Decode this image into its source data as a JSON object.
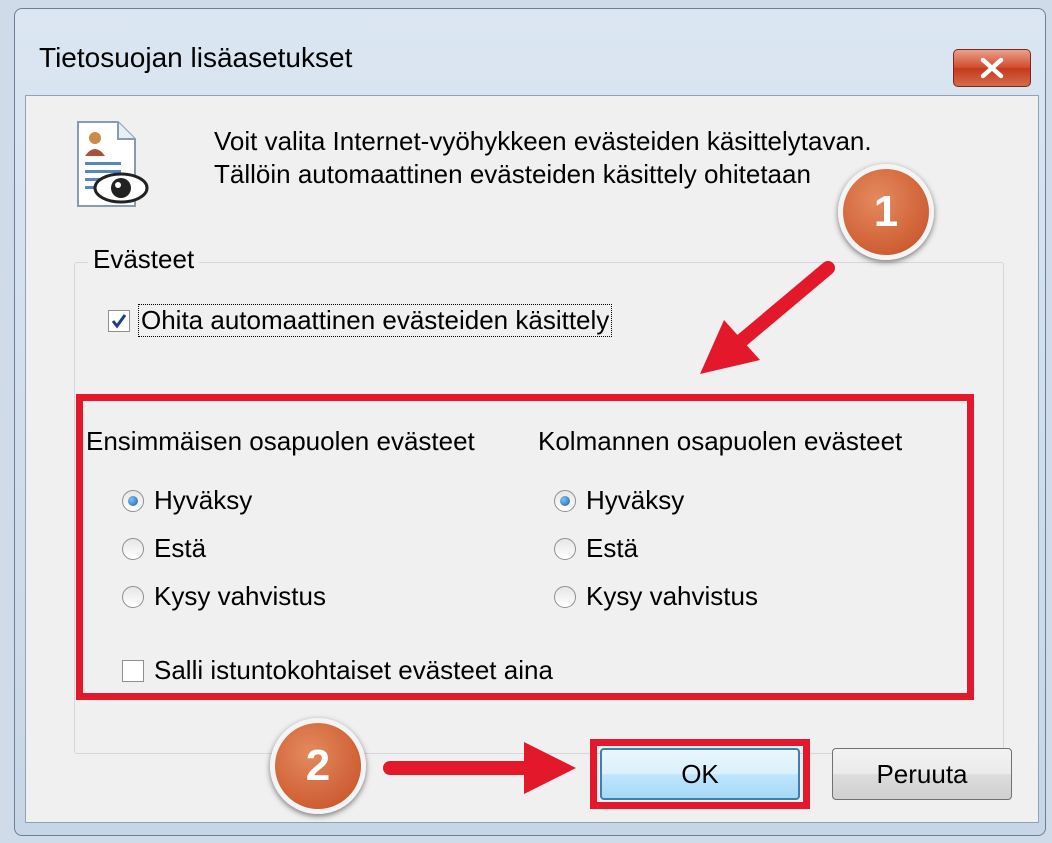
{
  "window": {
    "title": "Tietosuojan lisäasetukset",
    "close_icon": "close-x-icon"
  },
  "info": {
    "icon": "privacy-document-eye-icon",
    "line1": "Voit valita Internet-vyöhykkeen evästeiden käsittelytavan.",
    "line2": "Tällöin automaattinen evästeiden käsittely ohitetaan"
  },
  "cookies_group": {
    "label": "Evästeet",
    "override_label": "Ohita automaattinen evästeiden käsittely",
    "override_checked": true,
    "first_party": {
      "header": "Ensimmäisen osapuolen evästeet",
      "options": [
        "Hyväksy",
        "Estä",
        "Kysy vahvistus"
      ],
      "selected": "Hyväksy"
    },
    "third_party": {
      "header": "Kolmannen osapuolen evästeet",
      "options": [
        "Hyväksy",
        "Estä",
        "Kysy vahvistus"
      ],
      "selected": "Hyväksy"
    },
    "session_label": "Salli istuntokohtaiset evästeet aina",
    "session_checked": false
  },
  "buttons": {
    "ok": "OK",
    "cancel": "Peruuta"
  },
  "annotations": {
    "badge1": "1",
    "badge2": "2",
    "highlight_color": "#e3192b",
    "badge_color": "#cf5f34"
  }
}
